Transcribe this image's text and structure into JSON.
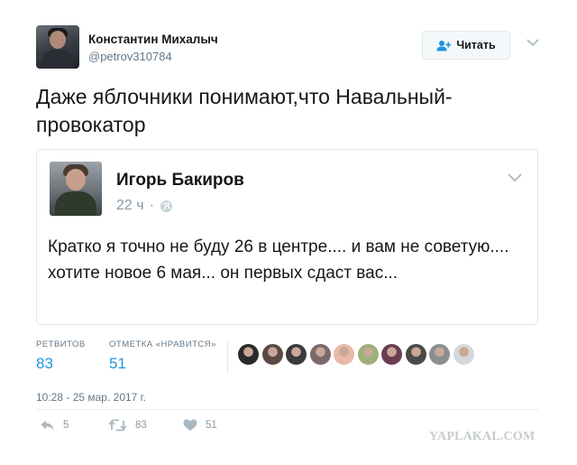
{
  "author": {
    "name": "Константин Михалыч",
    "handle": "@petrov310784"
  },
  "follow_button": {
    "label": "Читать",
    "icon": "add-user-icon"
  },
  "tweet": {
    "text": "Даже яблочники понимают,что Навальный-провокатор"
  },
  "quoted": {
    "name": "Игорь Бакиров",
    "time": "22 ч",
    "separator": "·",
    "privacy_icon": "globe-icon",
    "text": "Кратко я точно не буду 26 в центре.... и вам не советую.... хотите новое 6 мая... он первых сдаст вас..."
  },
  "stats": {
    "retweets_label": "РЕТВИТОВ",
    "retweets_value": "83",
    "likes_label": "ОТМЕТКА «НРАВИТСЯ»",
    "likes_value": "51"
  },
  "likers": [
    {
      "color": "#2b2b2b"
    },
    {
      "color": "#5a4a44"
    },
    {
      "color": "#3a3a3a"
    },
    {
      "color": "#7b6a6a"
    },
    {
      "color": "#e7b9a8"
    },
    {
      "color": "#9fb07a"
    },
    {
      "color": "#6a3d52"
    },
    {
      "color": "#4a4a4a"
    },
    {
      "color": "#8a8f92"
    },
    {
      "color": "#d5d8da"
    }
  ],
  "timestamp": "10:28 - 25 мар. 2017 г.",
  "actions": {
    "reply_count": "5",
    "retweet_count": "83",
    "like_count": "51"
  },
  "watermark": "YAPLAKAL.COM",
  "colors": {
    "accent": "#1b95e0",
    "muted": "#657786",
    "border": "#e1e8ed"
  }
}
